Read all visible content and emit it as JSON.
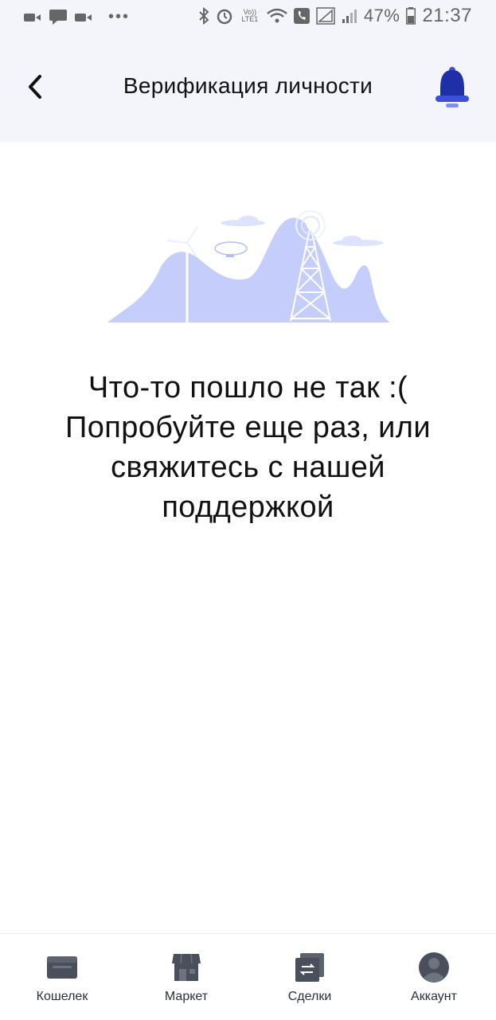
{
  "status_bar": {
    "battery": "47%",
    "time": "21:37",
    "network_label": "Vo)) LTE1"
  },
  "header": {
    "title": "Верификация личности"
  },
  "error": {
    "line1": "Что-то пошло не так :(",
    "line2": "Попробуйте еще раз, или",
    "line3": "свяжитесь с нашей",
    "line4": "поддержкой"
  },
  "tabbar": {
    "items": [
      {
        "label": "Кошелек",
        "icon": "wallet-icon"
      },
      {
        "label": "Маркет",
        "icon": "market-icon"
      },
      {
        "label": "Сделки",
        "icon": "deals-icon"
      },
      {
        "label": "Аккаунт",
        "icon": "account-icon"
      }
    ]
  },
  "colors": {
    "accent": "#3b4fd8",
    "illustration": "#c5cdfb",
    "header_bg": "#f4f5fa",
    "tab_icon": "#4a4f5c"
  }
}
